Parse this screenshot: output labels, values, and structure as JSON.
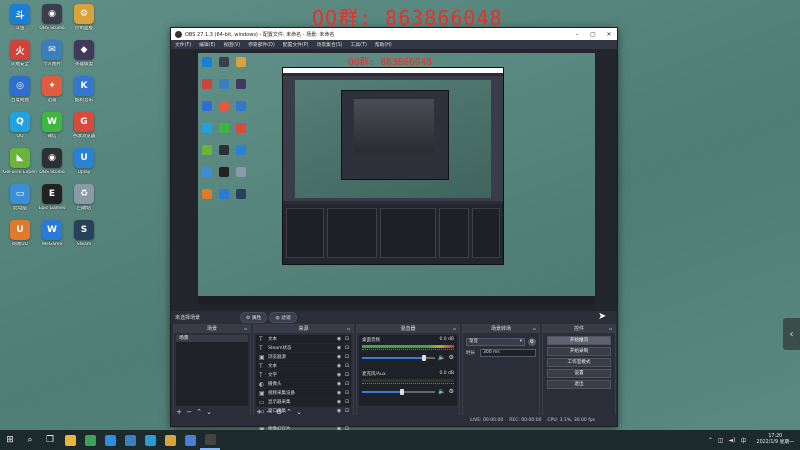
{
  "watermark": "QQ群: 863866048",
  "desktop_icons": [
    {
      "label": "斗鱼",
      "color": "#1c7fd6",
      "glyph": "斗",
      "icon": "douyu-icon"
    },
    {
      "label": "OBS Studio",
      "color": "#3b3e4a",
      "glyph": "◉",
      "icon": "obs-icon"
    },
    {
      "label": "控制面板",
      "color": "#d9a23a",
      "glyph": "⚙",
      "icon": "control-panel-icon"
    },
    {
      "label": "火绒安全",
      "color": "#d0433b",
      "glyph": "火",
      "icon": "shield-icon"
    },
    {
      "label": "个人图片",
      "color": "#3a7fbf",
      "glyph": "✉",
      "icon": "mail-icon"
    },
    {
      "label": "英雄联盟",
      "color": "#3f3a5a",
      "glyph": "◆",
      "icon": "game-icon"
    },
    {
      "label": "百度网盘",
      "color": "#2d6fd0",
      "glyph": "◎",
      "icon": "cloud-icon"
    },
    {
      "label": "迅雷",
      "color": "#e05b3f",
      "glyph": "✦",
      "icon": "thunder-icon"
    },
    {
      "label": "酷狗音乐",
      "color": "#3576cf",
      "glyph": "K",
      "icon": "music-icon"
    },
    {
      "label": "QQ",
      "color": "#20a3e0",
      "glyph": "Q",
      "icon": "qq-icon"
    },
    {
      "label": "微信",
      "color": "#3fb63f",
      "glyph": "W",
      "icon": "wechat-icon"
    },
    {
      "label": "谷歌浏览器",
      "color": "#d94a3a",
      "glyph": "G",
      "icon": "chrome-icon"
    },
    {
      "label": "GeForce Experience",
      "color": "#6ab43a",
      "glyph": "◣",
      "icon": "nvidia-icon"
    },
    {
      "label": "OBS Studio",
      "color": "#2e2f35",
      "glyph": "◉",
      "icon": "obs-studio-icon"
    },
    {
      "label": "Uplay",
      "color": "#2a82d6",
      "glyph": "U",
      "icon": "uplay-icon"
    },
    {
      "label": "此电脑",
      "color": "#3d8ed8",
      "glyph": "▭",
      "icon": "computer-icon"
    },
    {
      "label": "Epic Games",
      "color": "#222",
      "glyph": "E",
      "icon": "epic-icon"
    },
    {
      "label": "回收站",
      "color": "#8a9aa6",
      "glyph": "♻",
      "icon": "recycle-bin-icon"
    },
    {
      "label": "网易UU",
      "color": "#e07a2a",
      "glyph": "U",
      "icon": "uu-icon"
    },
    {
      "label": "WeGame",
      "color": "#2a7bd8",
      "glyph": "W",
      "icon": "wegame-icon"
    },
    {
      "label": "Steam",
      "color": "#26415a",
      "glyph": "S",
      "icon": "steam-icon"
    }
  ],
  "obs": {
    "title": "OBS 27.1.3 (64-bit, windows) - 配置文件: 未命名 - 场景: 未命名",
    "menu": [
      "文件(F)",
      "编辑(E)",
      "视图(V)",
      "停靠部件(D)",
      "配置文件(P)",
      "场景集合(S)",
      "工具(T)",
      "帮助(H)"
    ],
    "preview_watermark": "QQ群: 863866048",
    "current_scene": "未选择场景",
    "mode_buttons": [
      "属性",
      "滤镜"
    ],
    "docks": {
      "scenes": {
        "title": "场景",
        "items": [
          "场景"
        ]
      },
      "sources": {
        "title": "来源",
        "items": [
          {
            "name": "文本",
            "icon": "T"
          },
          {
            "name": "Steam状态",
            "icon": "T"
          },
          {
            "name": "浏览器源",
            "icon": "▣"
          },
          {
            "name": "文本",
            "icon": "T"
          },
          {
            "name": "文字",
            "icon": "T"
          },
          {
            "name": "摄像头",
            "icon": "◐"
          },
          {
            "name": "视频采集设备",
            "icon": "▣"
          },
          {
            "name": "显示器采集",
            "icon": "▭"
          },
          {
            "name": "窗口采集",
            "icon": "▭"
          },
          {
            "name": "游戏采集",
            "icon": "◈"
          },
          {
            "name": "图像幻灯片",
            "icon": "▣"
          }
        ]
      },
      "mixer": {
        "title": "混音器",
        "channels": [
          {
            "name": "桌面音频",
            "level": "0.0 dB",
            "volume": 0.85
          },
          {
            "name": "麦克风/Aux",
            "level": "0.0 dB",
            "volume": 0.55
          }
        ]
      },
      "transitions": {
        "title": "场景转场",
        "selected": "渐变",
        "duration_label": "时长",
        "duration_value": "300 ms"
      },
      "controls": {
        "title": "控件",
        "buttons": [
          "开始推流",
          "开始录制",
          "工作室模式",
          "设置",
          "退出"
        ]
      }
    },
    "status": {
      "live": "LIVE: 00:00:00",
      "rec": "REC: 00:00:00",
      "cpu": "CPU: 3.1%, 30.00 fps"
    }
  },
  "taskbar": {
    "apps": [
      {
        "name": "file-explorer",
        "color": "#e9b53a"
      },
      {
        "name": "chrome",
        "color": "#3aa356"
      },
      {
        "name": "qq",
        "color": "#2a8fe0"
      },
      {
        "name": "mail",
        "color": "#3a7fbf"
      },
      {
        "name": "edge",
        "color": "#2a9ad8"
      },
      {
        "name": "photos",
        "color": "#d9a23a"
      },
      {
        "name": "store",
        "color": "#4a7fd6"
      },
      {
        "name": "obs",
        "color": "#444"
      }
    ],
    "time": "17:20",
    "date": "2022/1/9 星期一"
  }
}
